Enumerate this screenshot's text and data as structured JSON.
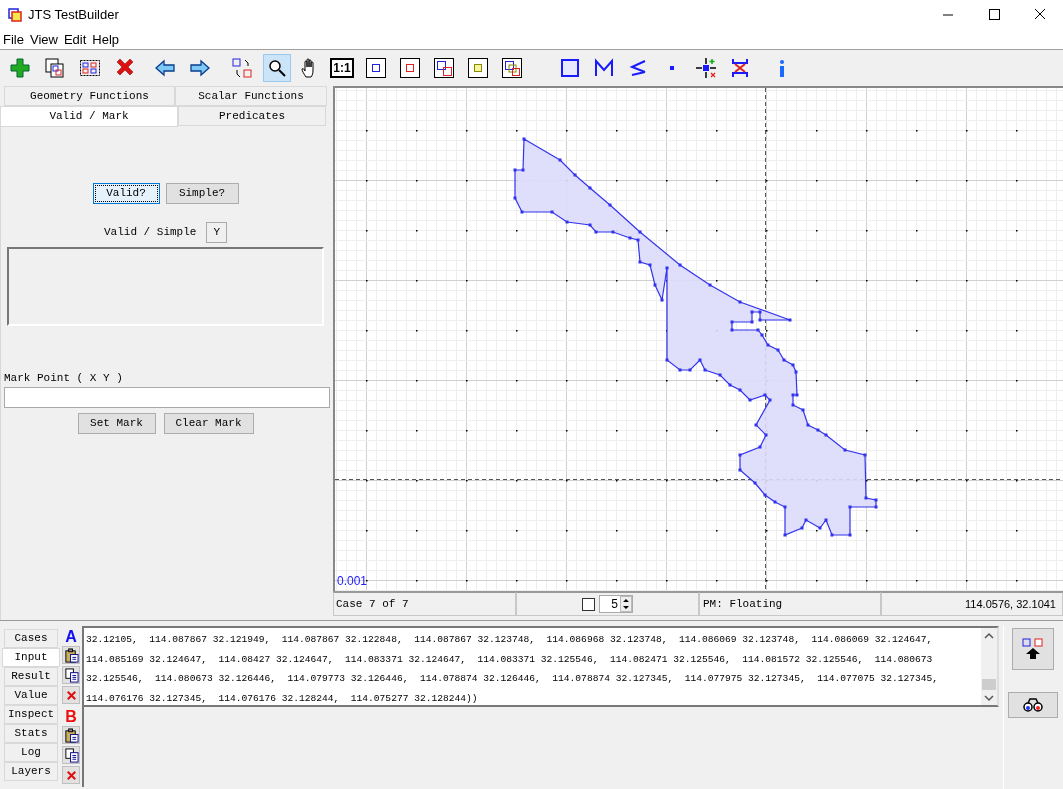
{
  "window": {
    "title": "JTS TestBuilder"
  },
  "menu": [
    "File",
    "View",
    "Edit",
    "Help"
  ],
  "toolbar": [
    {
      "selected": false
    },
    {
      "selected": false
    },
    {
      "selected": false
    },
    {
      "selected": false
    },
    {
      "selected": false
    },
    {
      "selected": false
    },
    {
      "selected": false
    },
    {
      "selected": true
    },
    {
      "selected": false
    },
    {
      "label": "1:1",
      "selected": false
    },
    {
      "selected": false
    },
    {
      "selected": false
    },
    {
      "selected": false
    },
    {
      "selected": false
    },
    {
      "selected": false
    },
    {
      "selected": false
    },
    {
      "selected": false
    },
    {
      "selected": false
    },
    {
      "selected": false
    },
    {
      "selected": false
    },
    {
      "selected": false
    },
    {
      "selected": false
    }
  ],
  "function_tabs": [
    {
      "label": "Geometry Functions",
      "selected": false
    },
    {
      "label": "Scalar Functions",
      "selected": false
    },
    {
      "label": "Valid / Mark",
      "selected": true
    },
    {
      "label": "Predicates",
      "selected": false
    }
  ],
  "valid_panel": {
    "buttons": [
      "Valid?",
      "Simple?"
    ],
    "result_label": "Valid / Simple",
    "result_value": "Y",
    "mark_label": "Mark Point ( X Y )",
    "mark_buttons": [
      "Set Mark",
      "Clear Mark"
    ]
  },
  "canvas": {
    "scale_label": "0.001"
  },
  "status_bar": {
    "case": "Case 7 of 7",
    "checkbox_checked": false,
    "spinner_value": "5",
    "precision": "PM: Floating",
    "coordinates": "114.0576, 32.1041"
  },
  "bottom_tabs": [
    {
      "label": "Cases",
      "selected": false
    },
    {
      "label": "Input",
      "selected": true
    },
    {
      "label": "Result",
      "selected": false
    },
    {
      "label": "Value",
      "selected": false
    },
    {
      "label": "Inspect",
      "selected": false
    },
    {
      "label": "Stats",
      "selected": false
    },
    {
      "label": "Log",
      "selected": false
    },
    {
      "label": "Layers",
      "selected": false
    }
  ],
  "geometry_a": {
    "label": "A",
    "lines": [
      "32.12105,  114.087867 32.121949,  114.087867 32.122848,  114.087867 32.123748,  114.086968 32.123748,  114.086069 32.123748,  114.086069 32.124647,",
      "114.085169 32.124647,  114.08427 32.124647,  114.083371 32.124647,  114.083371 32.125546,  114.082471 32.125546,  114.081572 32.125546,  114.080673",
      "32.125546,  114.080673 32.126446,  114.079773 32.126446,  114.078874 32.126446,  114.078874 32.127345,  114.077975 32.127345,  114.077075 32.127345,",
      "114.076176 32.127345,  114.076176 32.128244,  114.075277 32.128244))"
    ]
  },
  "geometry_b": {
    "label": "B"
  }
}
